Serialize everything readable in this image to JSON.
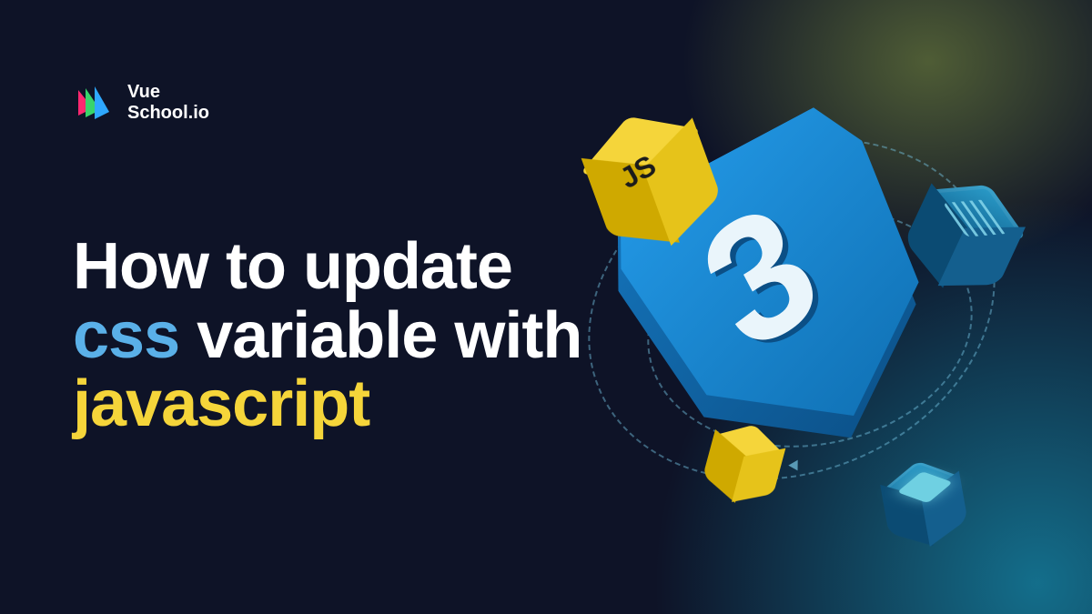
{
  "brand": {
    "line1": "Vue",
    "line2": "School.io"
  },
  "title": {
    "part1": "How to update ",
    "part2_css": "css",
    "part3": " variable with ",
    "part4_js": "javascript"
  },
  "js_badge": "JS",
  "shield_glyph": "3",
  "colors": {
    "bg": "#0e1327",
    "css_highlight": "#5ab0e8",
    "js_highlight": "#f5d53a",
    "shield_blue": "#1a8fd8"
  }
}
